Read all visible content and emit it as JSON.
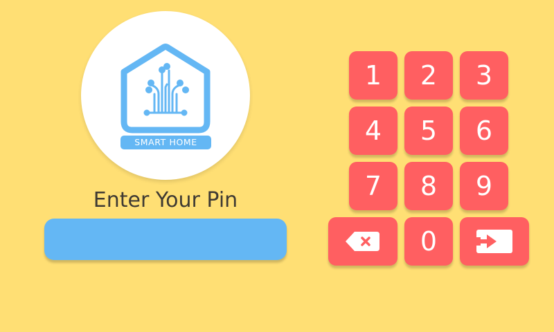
{
  "logo": {
    "caption": "SMART HOME",
    "icon": "smart-home-circuit-house-icon"
  },
  "prompt": "Enter Your Pin",
  "pin_input": {
    "value": ""
  },
  "keypad": {
    "keys": [
      "1",
      "2",
      "3",
      "4",
      "5",
      "6",
      "7",
      "8",
      "9",
      "0"
    ],
    "backspace_icon": "backspace-icon",
    "enter_icon": "enter-icon"
  },
  "colors": {
    "background": "#FFDF74",
    "key": "#FF5F61",
    "accent_blue": "#64B7F4",
    "text": "#3F3A33"
  }
}
